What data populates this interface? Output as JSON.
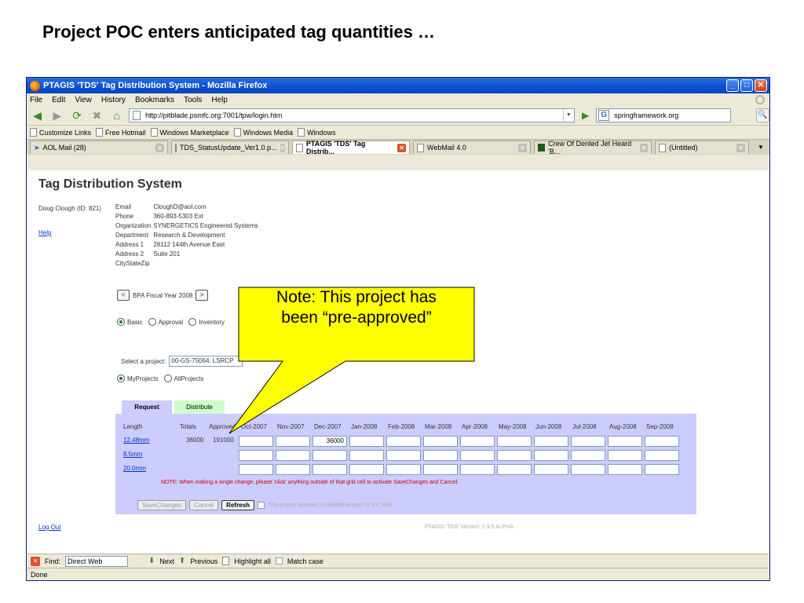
{
  "slide": {
    "title": "Project POC enters anticipated tag quantities …"
  },
  "window": {
    "title": "PTAGIS 'TDS' Tag Distribution System - Mozilla Firefox"
  },
  "menu": [
    "File",
    "Edit",
    "View",
    "History",
    "Bookmarks",
    "Tools",
    "Help"
  ],
  "nav": {
    "url": "http://pitblade.psmfc.org:7001/tpw/login.htm",
    "search_value": "springframework.org"
  },
  "links": [
    "Customize Links",
    "Free Hotmail",
    "Windows Marketplace",
    "Windows Media",
    "Windows"
  ],
  "tabs": [
    {
      "label": "AOL Mail (28)"
    },
    {
      "label": "TDS_StatusUpdate_Ver1.0.p..."
    },
    {
      "label": "PTAGIS 'TDS' Tag Distrib..."
    },
    {
      "label": "WebMail 4.0"
    },
    {
      "label": "Crew Of Dented Jet Heard 'B..."
    },
    {
      "label": "(Untitled)"
    }
  ],
  "page": {
    "heading": "Tag Distribution System",
    "user": "Doug Clough (ID: 821)",
    "help": "Help",
    "info": [
      {
        "k": "Email",
        "v": "CloughD@aol.com"
      },
      {
        "k": "Phone",
        "v": "360-893-5303 Ext"
      },
      {
        "k": "Organization",
        "v": "SYNERGETICS Engineered Systems"
      },
      {
        "k": "Department",
        "v": "Research & Development"
      },
      {
        "k": "Address 1",
        "v": "28112 144th Avenue East"
      },
      {
        "k": "Address 2",
        "v": "Suite 201"
      },
      {
        "k": "CityStateZip",
        "v": ""
      }
    ],
    "fiscal": {
      "prev": "<",
      "label": "BPA Fiscal Year 2008",
      "next": ">"
    },
    "view_modes": [
      "Basic",
      "Approval",
      "Inventory"
    ],
    "project_label": "Select a project:",
    "project_value": "00-GS-75064: LSRCP",
    "scope": [
      "MyProjects",
      "AllProjects"
    ],
    "tab_request": "Request",
    "tab_distribute": "Distribute",
    "grid": {
      "headers": [
        "Length",
        "Totals",
        "Approved",
        "Oct-2007",
        "Nov-2007",
        "Dec-2007",
        "Jan-2008",
        "Feb-2008",
        "Mar-2008",
        "Apr-2008",
        "May-2008",
        "Jun-2008",
        "Jul-2008",
        "Aug-2008",
        "Sep-2008"
      ],
      "rows": [
        {
          "length": "12.48mm",
          "total": "36000",
          "approved": "191000",
          "cells": [
            "",
            "",
            "36000",
            "",
            "",
            "",
            "",
            "",
            "",
            "",
            "",
            ""
          ]
        },
        {
          "length": "8.5mm",
          "total": "",
          "approved": "",
          "cells": [
            "",
            "",
            "",
            "",
            "",
            "",
            "",
            "",
            "",
            "",
            "",
            ""
          ]
        },
        {
          "length": "20.0mm",
          "total": "",
          "approved": "",
          "cells": [
            "",
            "",
            "",
            "",
            "",
            "",
            "",
            "",
            "",
            "",
            "",
            ""
          ]
        }
      ],
      "note": "NOTE: When making a single change, please 'click' anything outside of that grid cell to activate SaveChanges and Cancel.",
      "save": "SaveChanges",
      "cancel": "Cancel",
      "refresh": "Refresh",
      "no_tags": "This project requires no additional tags for FY 2008"
    },
    "logout": "Log Out",
    "version": "PTAGIS 'TDS' Version: 0.9.5 ALPHA"
  },
  "find": {
    "label": "Find:",
    "value": "Direct Web",
    "next": "Next",
    "previous": "Previous",
    "highlight": "Highlight all",
    "match": "Match case"
  },
  "status": "Done",
  "callout": {
    "line1": "Note: This project has",
    "line2": "been “pre-approved”",
    "fill": "#ffff00"
  }
}
